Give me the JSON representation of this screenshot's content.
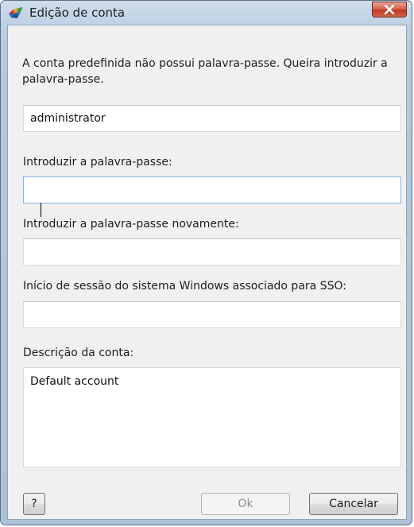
{
  "window": {
    "title": "Edição de conta",
    "app_icon": "avg-logo-icon",
    "close_icon": "close-icon"
  },
  "dialog": {
    "message": "A conta predefinida não possui palavra-passe. Queira introduzir a palavra-passe.",
    "account_name_value": "administrator",
    "password_label": "Introduzir a palavra-passe:",
    "password_value": "",
    "password_confirm_label": "Introduzir a palavra-passe novamente:",
    "password_confirm_value": "",
    "sso_label": "Início de sessão do sistema Windows associado para SSO:",
    "sso_value": "",
    "description_label": "Descrição da conta:",
    "description_value": "Default account"
  },
  "buttons": {
    "help_label": "?",
    "ok_label": "Ok",
    "cancel_label": "Cancelar"
  },
  "colors": {
    "titlebar": "#bfd1e5",
    "close_button": "#c13a22",
    "client_background": "#f0f0f0",
    "focus_border": "#7eb4ea"
  }
}
